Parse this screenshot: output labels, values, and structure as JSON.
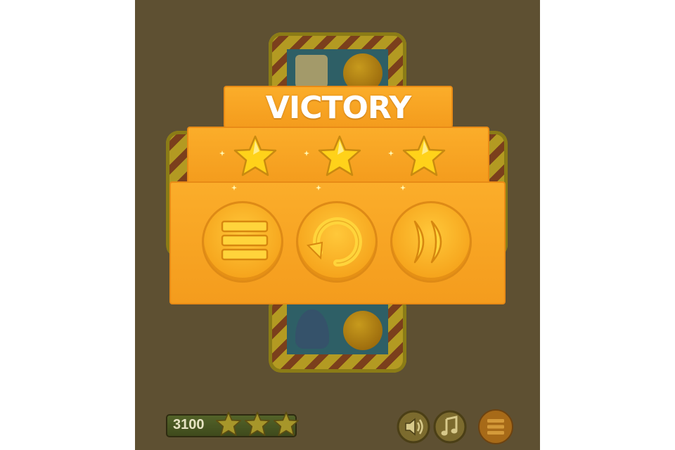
{
  "overlay": {
    "title": "VICTORY",
    "stars_earned": 3,
    "stars_total": 3,
    "buttons": [
      {
        "name": "level-menu-button",
        "icon": "menu-lines-icon"
      },
      {
        "name": "replay-button",
        "icon": "restart-arrow-icon"
      },
      {
        "name": "next-level-button",
        "icon": "fast-forward-icon"
      }
    ]
  },
  "hud": {
    "score": "3100",
    "stars_earned": 3,
    "buttons": [
      {
        "name": "sound-toggle-button",
        "icon": "speaker-icon"
      },
      {
        "name": "music-toggle-button",
        "icon": "music-note-icon"
      },
      {
        "name": "pause-menu-button",
        "icon": "menu-lines-icon"
      }
    ]
  },
  "colors": {
    "panel_orange": "#f7a524",
    "panel_border": "#e88b16",
    "star_yellow": "#ffd21a",
    "dim_background": "#5e5032"
  }
}
